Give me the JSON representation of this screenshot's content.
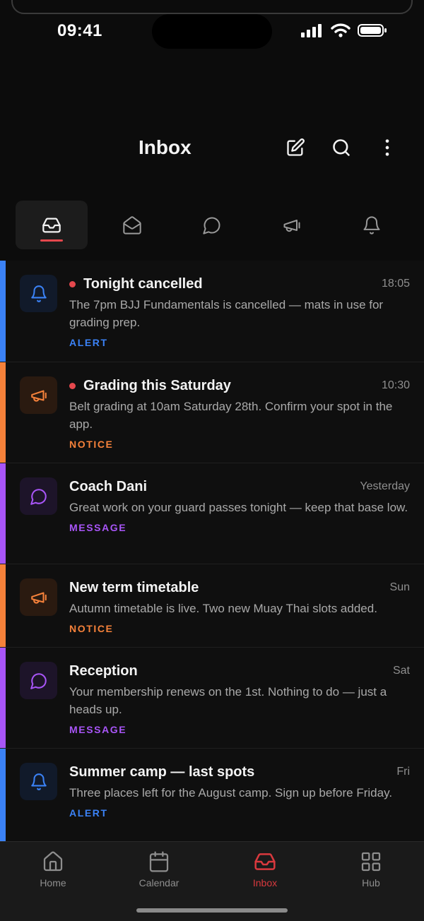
{
  "status": {
    "time": "09:41"
  },
  "header": {
    "title": "Inbox"
  },
  "tabs": [
    {
      "name": "all",
      "icon": "inbox-tray-icon"
    },
    {
      "name": "mail",
      "icon": "envelope-open-icon"
    },
    {
      "name": "messages",
      "icon": "chat-bubble-icon"
    },
    {
      "name": "notices",
      "icon": "megaphone-icon"
    },
    {
      "name": "alerts",
      "icon": "bell-icon"
    }
  ],
  "colors": {
    "alert": "#3b82f6",
    "notice": "#f5813a",
    "message": "#a855f7",
    "active": "#e5484d"
  },
  "messages": [
    {
      "subject": "Tonight cancelled",
      "time": "18:05",
      "unread": true,
      "body": "The 7pm BJJ Fundamentals is cancelled — mats in use for grading prep.",
      "tag": "ALERT",
      "type": "alert"
    },
    {
      "subject": "Grading this Saturday",
      "time": "10:30",
      "unread": true,
      "body": "Belt grading at 10am Saturday 28th. Confirm your spot in the app.",
      "tag": "NOTICE",
      "type": "notice"
    },
    {
      "subject": "Coach Dani",
      "time": "Yesterday",
      "unread": false,
      "body": "Great work on your guard passes tonight — keep that base low.",
      "tag": "MESSAGE",
      "type": "message"
    },
    {
      "subject": "New term timetable",
      "time": "Sun",
      "unread": false,
      "body": "Autumn timetable is live. Two new Muay Thai slots added.",
      "tag": "NOTICE",
      "type": "notice"
    },
    {
      "subject": "Reception",
      "time": "Sat",
      "unread": false,
      "body": "Your membership renews on the 1st. Nothing to do — just a heads up.",
      "tag": "MESSAGE",
      "type": "message"
    },
    {
      "subject": "Summer camp — last spots",
      "time": "Fri",
      "unread": false,
      "body": "Three places left for the August camp. Sign up before Friday.",
      "tag": "ALERT",
      "type": "alert"
    }
  ],
  "nav": [
    {
      "label": "Home",
      "icon": "home-icon"
    },
    {
      "label": "Calendar",
      "icon": "calendar-icon"
    },
    {
      "label": "Inbox",
      "icon": "inbox-tray-icon",
      "active": true
    },
    {
      "label": "Hub",
      "icon": "grid-icon"
    }
  ]
}
